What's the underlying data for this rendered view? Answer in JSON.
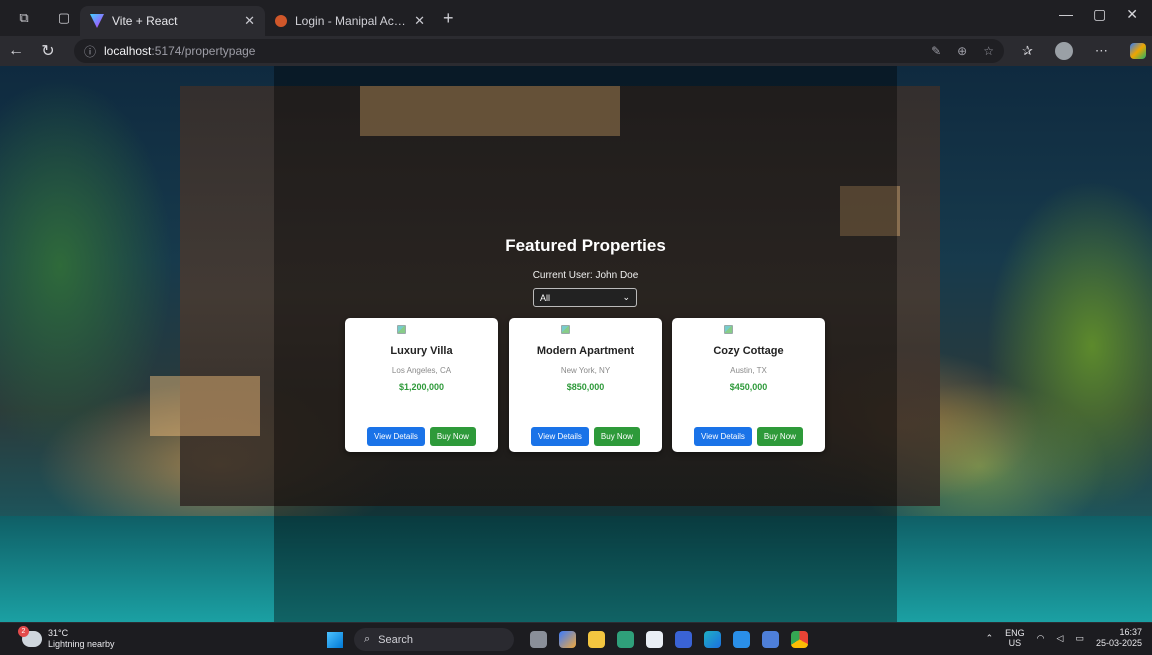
{
  "browser": {
    "tabs": [
      {
        "title": "Vite + React",
        "active": true
      },
      {
        "title": "Login - Manipal Academy of High",
        "active": false
      }
    ],
    "url_host": "localhost",
    "url_path": ":5174/propertypage"
  },
  "page": {
    "heading": "Featured Properties",
    "current_user": "Current User: John Doe",
    "filter": {
      "selected": "All"
    },
    "properties": [
      {
        "name": "Luxury Villa",
        "location": "Los Angeles, CA",
        "price": "$1,200,000",
        "view_label": "View Details",
        "buy_label": "Buy Now"
      },
      {
        "name": "Modern Apartment",
        "location": "New York, NY",
        "price": "$850,000",
        "view_label": "View Details",
        "buy_label": "Buy Now"
      },
      {
        "name": "Cozy Cottage",
        "location": "Austin, TX",
        "price": "$450,000",
        "view_label": "View Details",
        "buy_label": "Buy Now"
      }
    ]
  },
  "taskbar": {
    "weather_temp": "31°C",
    "weather_desc": "Lightning nearby",
    "weather_badge": "2",
    "search_placeholder": "Search",
    "lang_line1": "ENG",
    "lang_line2": "US",
    "time": "16:37",
    "date": "25-03-2025"
  },
  "colors": {
    "view_button": "#1a73e8",
    "buy_button": "#2e9a3a",
    "price_text": "#2e9a3a"
  }
}
